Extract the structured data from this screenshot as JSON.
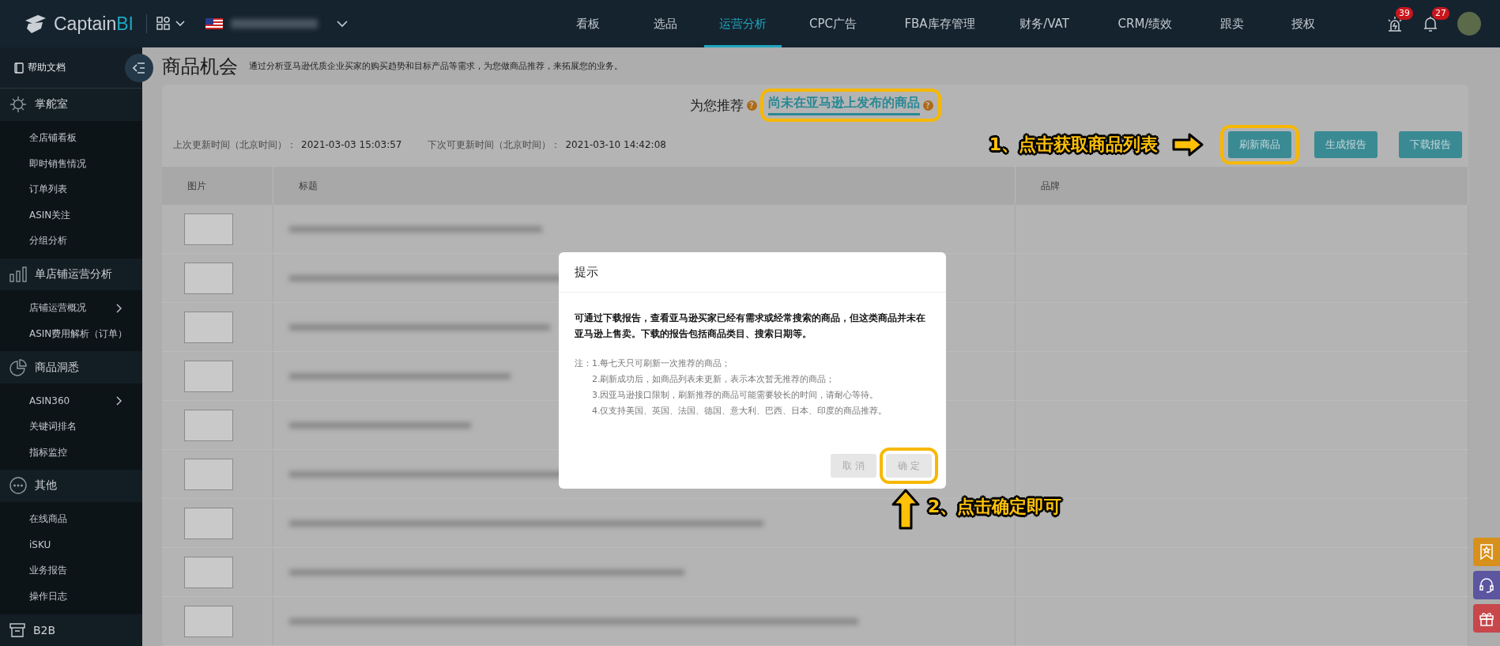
{
  "topbar": {
    "logo": {
      "text": "Captain",
      "accent": "BI"
    },
    "nav": [
      {
        "label": "看板",
        "selected": false
      },
      {
        "label": "选品",
        "selected": false
      },
      {
        "label": "运营分析",
        "selected": true
      },
      {
        "label": "CPC广告",
        "selected": false
      },
      {
        "label": "FBA库存管理",
        "selected": false
      },
      {
        "label": "财务/VAT",
        "selected": false
      },
      {
        "label": "CRM/绩效",
        "selected": false
      },
      {
        "label": "跟卖",
        "selected": false
      },
      {
        "label": "授权",
        "selected": false
      }
    ],
    "badges": [
      "39",
      "27"
    ]
  },
  "sidebar": {
    "help": "帮助文档",
    "groups": [
      {
        "title": "掌舵室",
        "items": [
          {
            "label": "全店铺看板",
            "submenu": false
          },
          {
            "label": "即时销售情况",
            "submenu": false
          },
          {
            "label": "订单列表",
            "submenu": false
          },
          {
            "label": "ASIN关注",
            "submenu": false
          },
          {
            "label": "分组分析",
            "submenu": false
          }
        ]
      },
      {
        "title": "单店铺运营分析",
        "items": [
          {
            "label": "店铺运营概况",
            "submenu": true
          },
          {
            "label": "ASIN费用解析（订单）",
            "submenu": false
          }
        ]
      },
      {
        "title": "商品洞悉",
        "items": [
          {
            "label": "ASIN360",
            "submenu": true
          },
          {
            "label": "关键词排名",
            "submenu": false
          },
          {
            "label": "指标监控",
            "submenu": false
          }
        ]
      },
      {
        "title": "其他",
        "items": [
          {
            "label": "在线商品",
            "submenu": false
          },
          {
            "label": "iSKU",
            "submenu": false
          },
          {
            "label": "业务报告",
            "submenu": false
          },
          {
            "label": "操作日志",
            "submenu": false
          }
        ]
      },
      {
        "title": "B2B"
      }
    ]
  },
  "page": {
    "title": "商品机会",
    "subtitle": "通过分析亚马逊优质企业买家的购买趋势和目标产品等需求，为您做商品推荐，来拓展您的业务。",
    "recommend_label": "为您推荐",
    "recommend_hint": "?",
    "tabs": [
      {
        "label": "尚未在亚马逊上发布的商品",
        "hint": "?",
        "selected": true,
        "highlighted": true
      }
    ],
    "last_update_label": "上次更新时间（北京时间）：",
    "last_update": "2021-03-03 15:03:57",
    "next_update_label": "下次可更新时间（北京时间）：",
    "next_update": "2021-03-10 14:42:08",
    "buttons": [
      {
        "label": "刷新商品",
        "highlighted": true
      },
      {
        "label": "生成报告",
        "highlighted": false
      },
      {
        "label": "下载报告",
        "highlighted": false
      }
    ],
    "table": {
      "columns": [
        "图片",
        "标题",
        "品牌"
      ],
      "rows": [
        {
          "kind": "blurred"
        },
        {
          "kind": "blurred"
        },
        {
          "kind": "blurred"
        },
        {
          "kind": "blurred"
        },
        {
          "kind": "blurred"
        },
        {
          "kind": "blurred"
        },
        {
          "kind": "blurred"
        },
        {
          "kind": "blurred"
        },
        {
          "kind": "blurred"
        }
      ]
    }
  },
  "dialog": {
    "title": "提示",
    "message": "可通过下载报告，查看亚马逊买家已经有需求或经常搜索的商品，但这类商品并未在亚马逊上售卖。下载的报告包括商品类目、搜索日期等。",
    "notes_label": "注：",
    "notes": [
      "1.每七天只可刷新一次推荐的商品；",
      "2.刷新成功后，如商品列表未更新，表示本次暂无推荐的商品；",
      "3.因亚马逊接口限制，刷新推荐的商品可能需要较长的时间，请耐心等待。",
      "4.仅支持美国、英国、法国、德国、意大利、巴西、日本、印度的商品推荐。"
    ],
    "buttons": [
      {
        "label": "取 消",
        "highlighted": false
      },
      {
        "label": "确 定",
        "highlighted": true
      }
    ]
  },
  "annotations": [
    {
      "text": "1、点击获取商品列表"
    },
    {
      "text": "2、点击确定即可"
    }
  ]
}
